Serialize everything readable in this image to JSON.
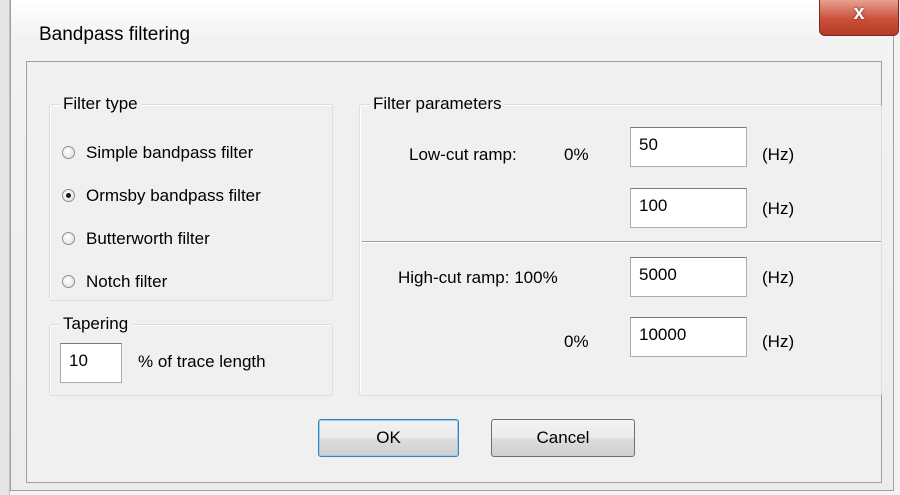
{
  "window": {
    "title": "Bandpass filtering",
    "close_label": "x"
  },
  "filter_type": {
    "legend": "Filter type",
    "options": [
      {
        "label": "Simple bandpass filter",
        "checked": false
      },
      {
        "label": "Ormsby bandpass filter",
        "checked": true
      },
      {
        "label": "Butterworth filter",
        "checked": false
      },
      {
        "label": "Notch filter",
        "checked": false
      }
    ]
  },
  "tapering": {
    "legend": "Tapering",
    "value": "10",
    "suffix": "% of trace length"
  },
  "filter_parameters": {
    "legend": "Filter parameters",
    "low_cut": {
      "label": "Low-cut ramp:",
      "pct_0": "0%",
      "value_0": "50",
      "value_100": "100",
      "unit": "(Hz)"
    },
    "high_cut": {
      "label": "High-cut ramp: 100%",
      "value_100": "5000",
      "pct_0": "0%",
      "value_0": "10000",
      "unit": "(Hz)"
    }
  },
  "buttons": {
    "ok": "OK",
    "cancel": "Cancel"
  }
}
